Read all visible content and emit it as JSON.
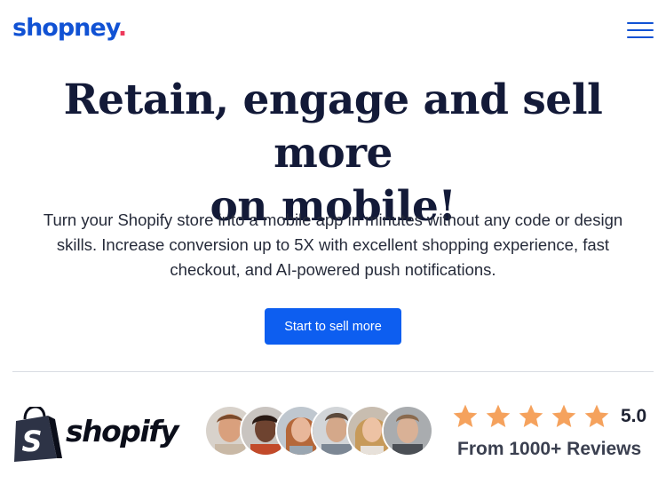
{
  "header": {
    "logo_text": "shopney",
    "logo_dot": ".",
    "menu_icon": "hamburger-menu-icon"
  },
  "hero": {
    "title_line1": "Retain, engage and sell more",
    "title_line2": "on mobile!",
    "subtitle_line1": "Turn your Shopify store into a mobile app in minutes without any code or design",
    "subtitle_line2": "skills. Increase conversion up to 5X with excellent shopping experience, fast",
    "subtitle_line3": "checkout, and AI-powered push notifications.",
    "cta_label": "Start to sell more"
  },
  "social_proof": {
    "partner_logo_text": "shopify",
    "partner_icon": "shopify-bag-icon",
    "avatars": [
      {
        "name": "reviewer-avatar-1"
      },
      {
        "name": "reviewer-avatar-2"
      },
      {
        "name": "reviewer-avatar-3"
      },
      {
        "name": "reviewer-avatar-4"
      },
      {
        "name": "reviewer-avatar-5"
      },
      {
        "name": "reviewer-avatar-6"
      }
    ],
    "stars": 5,
    "rating": "5.0",
    "reviews_text": "From 1000+ Reviews"
  },
  "colors": {
    "brand_blue": "#1152d4",
    "brand_dot": "#ee3a5b",
    "cta_bg": "#0d5ef0",
    "star": "#f5a25d",
    "title": "#131a38"
  }
}
